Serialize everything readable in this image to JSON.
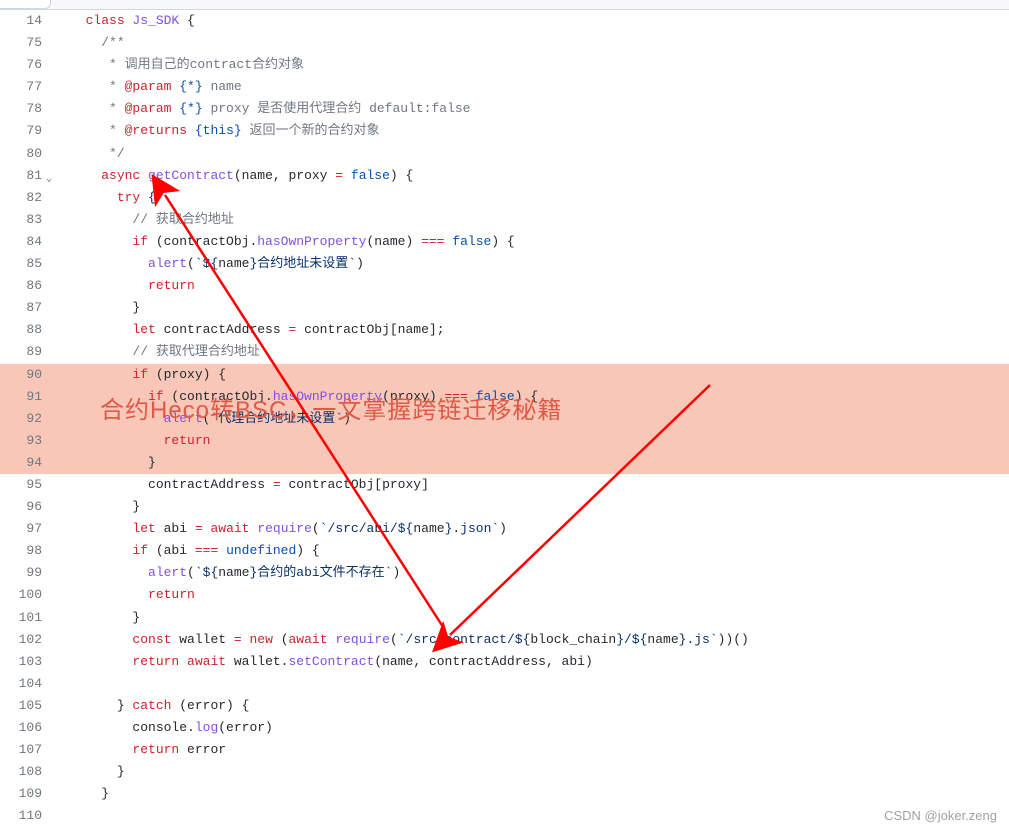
{
  "watermark_overlay": "合约Heco转BSC，一文掌握跨链迁移秘籍",
  "csdn_mark": "CSDN @joker.zeng",
  "colors": {
    "keyword": "#cf222e",
    "function": "#8250df",
    "string": "#0a3069",
    "comment": "#6e7781",
    "highlight_bg": "#f8c7b8",
    "arrow": "#ff0000"
  },
  "lines": [
    {
      "n": 14,
      "indent": 1,
      "tokens": [
        [
          "k",
          "class "
        ],
        [
          "fn",
          "Js_SDK"
        ],
        [
          "pl",
          " {"
        ]
      ]
    },
    {
      "n": 75,
      "indent": 2,
      "tokens": [
        [
          "c",
          "/**"
        ]
      ]
    },
    {
      "n": 76,
      "indent": 2,
      "tokens": [
        [
          "c",
          " * 调用自己的contract合约对象"
        ]
      ]
    },
    {
      "n": 77,
      "indent": 2,
      "tokens": [
        [
          "c",
          " * "
        ],
        [
          "k",
          "@param"
        ],
        [
          "c",
          " "
        ],
        [
          "kw2",
          "{*}"
        ],
        [
          "c",
          " name"
        ]
      ]
    },
    {
      "n": 78,
      "indent": 2,
      "tokens": [
        [
          "c",
          " * "
        ],
        [
          "k",
          "@param"
        ],
        [
          "c",
          " "
        ],
        [
          "kw2",
          "{*}"
        ],
        [
          "c",
          " proxy 是否使用代理合约 default:false"
        ]
      ]
    },
    {
      "n": 79,
      "indent": 2,
      "tokens": [
        [
          "c",
          " * "
        ],
        [
          "k",
          "@returns"
        ],
        [
          "c",
          " "
        ],
        [
          "kw2",
          "{this}"
        ],
        [
          "c",
          " 返回一个新的合约对象"
        ]
      ]
    },
    {
      "n": 80,
      "indent": 2,
      "tokens": [
        [
          "c",
          " */"
        ]
      ]
    },
    {
      "n": 81,
      "indent": 2,
      "chevron": true,
      "tokens": [
        [
          "k",
          "async "
        ],
        [
          "fn",
          "getContract"
        ],
        [
          "pl",
          "(name, proxy "
        ],
        [
          "op",
          "="
        ],
        [
          "pl",
          " "
        ],
        [
          "kw2",
          "false"
        ],
        [
          "pl",
          ") {"
        ]
      ]
    },
    {
      "n": 82,
      "indent": 3,
      "tokens": [
        [
          "k",
          "try"
        ],
        [
          "pl",
          " {"
        ]
      ]
    },
    {
      "n": 83,
      "indent": 4,
      "tokens": [
        [
          "c",
          "// 获取合约地址"
        ]
      ]
    },
    {
      "n": 84,
      "indent": 4,
      "tokens": [
        [
          "k",
          "if"
        ],
        [
          "pl",
          " (contractObj."
        ],
        [
          "fn",
          "hasOwnProperty"
        ],
        [
          "pl",
          "(name) "
        ],
        [
          "op",
          "==="
        ],
        [
          "pl",
          " "
        ],
        [
          "kw2",
          "false"
        ],
        [
          "pl",
          ") {"
        ]
      ]
    },
    {
      "n": 85,
      "indent": 5,
      "tokens": [
        [
          "fn",
          "alert"
        ],
        [
          "pl",
          "("
        ],
        [
          "s",
          "`${"
        ],
        [
          "pl",
          "name"
        ],
        [
          "s",
          "}合约地址未设置`"
        ],
        [
          "pl",
          ")"
        ]
      ]
    },
    {
      "n": 86,
      "indent": 5,
      "tokens": [
        [
          "k",
          "return"
        ]
      ]
    },
    {
      "n": 87,
      "indent": 4,
      "tokens": [
        [
          "pl",
          "}"
        ]
      ]
    },
    {
      "n": 88,
      "indent": 4,
      "tokens": [
        [
          "k",
          "let"
        ],
        [
          "pl",
          " contractAddress "
        ],
        [
          "op",
          "="
        ],
        [
          "pl",
          " contractObj[name];"
        ]
      ]
    },
    {
      "n": 89,
      "indent": 4,
      "tokens": [
        [
          "c",
          "// 获取代理合约地址"
        ]
      ]
    },
    {
      "n": 90,
      "indent": 4,
      "hl": true,
      "tokens": [
        [
          "k",
          "if"
        ],
        [
          "pl",
          " (proxy) {"
        ]
      ]
    },
    {
      "n": 91,
      "indent": 5,
      "hl": true,
      "tokens": [
        [
          "k",
          "if"
        ],
        [
          "pl",
          " (contractObj."
        ],
        [
          "fn",
          "hasOwnProperty"
        ],
        [
          "pl",
          "(proxy) "
        ],
        [
          "op",
          "==="
        ],
        [
          "pl",
          " "
        ],
        [
          "kw2",
          "false"
        ],
        [
          "pl",
          ") {"
        ]
      ]
    },
    {
      "n": 92,
      "indent": 6,
      "hl": true,
      "tokens": [
        [
          "fn",
          "alert"
        ],
        [
          "pl",
          "("
        ],
        [
          "s",
          "`代理合约地址未设置`"
        ],
        [
          "pl",
          ")"
        ]
      ]
    },
    {
      "n": 93,
      "indent": 6,
      "hl": true,
      "tokens": [
        [
          "k",
          "return"
        ]
      ]
    },
    {
      "n": 94,
      "indent": 5,
      "hl": true,
      "tokens": [
        [
          "pl",
          "}"
        ]
      ]
    },
    {
      "n": 95,
      "indent": 5,
      "tokens": [
        [
          "pl",
          "contractAddress "
        ],
        [
          "op",
          "="
        ],
        [
          "pl",
          " contractObj[proxy]"
        ]
      ]
    },
    {
      "n": 96,
      "indent": 4,
      "tokens": [
        [
          "pl",
          "}"
        ]
      ]
    },
    {
      "n": 97,
      "indent": 4,
      "tokens": [
        [
          "k",
          "let"
        ],
        [
          "pl",
          " abi "
        ],
        [
          "op",
          "="
        ],
        [
          "pl",
          " "
        ],
        [
          "k",
          "await"
        ],
        [
          "pl",
          " "
        ],
        [
          "fn",
          "require"
        ],
        [
          "pl",
          "("
        ],
        [
          "s",
          "`/src/abi/${"
        ],
        [
          "pl",
          "name"
        ],
        [
          "s",
          "}.json`"
        ],
        [
          "pl",
          ")"
        ]
      ]
    },
    {
      "n": 98,
      "indent": 4,
      "tokens": [
        [
          "k",
          "if"
        ],
        [
          "pl",
          " (abi "
        ],
        [
          "op",
          "==="
        ],
        [
          "pl",
          " "
        ],
        [
          "kw2",
          "undefined"
        ],
        [
          "pl",
          ") {"
        ]
      ]
    },
    {
      "n": 99,
      "indent": 5,
      "tokens": [
        [
          "fn",
          "alert"
        ],
        [
          "pl",
          "("
        ],
        [
          "s",
          "`${"
        ],
        [
          "pl",
          "name"
        ],
        [
          "s",
          "}合约的abi文件不存在`"
        ],
        [
          "pl",
          ")"
        ]
      ]
    },
    {
      "n": 100,
      "indent": 5,
      "tokens": [
        [
          "k",
          "return"
        ]
      ]
    },
    {
      "n": 101,
      "indent": 4,
      "tokens": [
        [
          "pl",
          "}"
        ]
      ]
    },
    {
      "n": 102,
      "indent": 4,
      "tokens": [
        [
          "k",
          "const"
        ],
        [
          "pl",
          " wallet "
        ],
        [
          "op",
          "="
        ],
        [
          "pl",
          " "
        ],
        [
          "k",
          "new"
        ],
        [
          "pl",
          " ("
        ],
        [
          "k",
          "await"
        ],
        [
          "pl",
          " "
        ],
        [
          "fn",
          "require"
        ],
        [
          "pl",
          "("
        ],
        [
          "s",
          "`/src/contract/${"
        ],
        [
          "pl",
          "block_chain"
        ],
        [
          "s",
          "}/${"
        ],
        [
          "pl",
          "name"
        ],
        [
          "s",
          "}.js`"
        ],
        [
          "pl",
          "))()"
        ]
      ]
    },
    {
      "n": 103,
      "indent": 4,
      "tokens": [
        [
          "k",
          "return"
        ],
        [
          "pl",
          " "
        ],
        [
          "k",
          "await"
        ],
        [
          "pl",
          " wallet."
        ],
        [
          "fn",
          "setContract"
        ],
        [
          "pl",
          "(name, contractAddress, abi)"
        ]
      ]
    },
    {
      "n": 104,
      "indent": 0,
      "tokens": [
        [
          "pl",
          ""
        ]
      ]
    },
    {
      "n": 105,
      "indent": 3,
      "tokens": [
        [
          "pl",
          "} "
        ],
        [
          "k",
          "catch"
        ],
        [
          "pl",
          " (error) {"
        ]
      ]
    },
    {
      "n": 106,
      "indent": 4,
      "tokens": [
        [
          "pl",
          "console."
        ],
        [
          "fn",
          "log"
        ],
        [
          "pl",
          "(error)"
        ]
      ]
    },
    {
      "n": 107,
      "indent": 4,
      "tokens": [
        [
          "k",
          "return"
        ],
        [
          "pl",
          " error"
        ]
      ]
    },
    {
      "n": 108,
      "indent": 3,
      "tokens": [
        [
          "pl",
          "}"
        ]
      ]
    },
    {
      "n": 109,
      "indent": 2,
      "tokens": [
        [
          "pl",
          "}"
        ]
      ]
    },
    {
      "n": 110,
      "indent": 0,
      "tokens": [
        [
          "pl",
          ""
        ]
      ]
    }
  ]
}
